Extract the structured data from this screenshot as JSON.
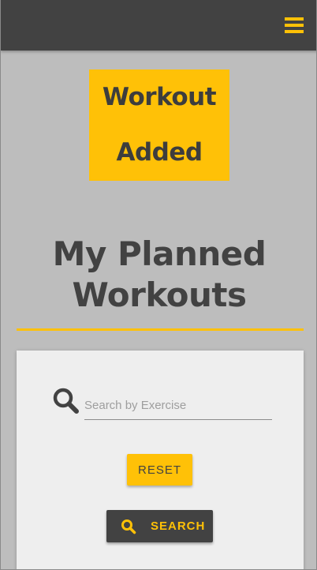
{
  "header": {
    "menu_icon": "hamburger-menu-icon",
    "accent_color": "#ffc107",
    "bar_color": "#424242"
  },
  "notice": {
    "line1": "Workout",
    "line2": "Added"
  },
  "page": {
    "title_line1": "My Planned",
    "title_line2": "Workouts"
  },
  "search": {
    "icon": "search-icon",
    "placeholder": "Search by Exercise",
    "value": "",
    "reset_label": "RESET",
    "search_label": "SEARCH"
  }
}
